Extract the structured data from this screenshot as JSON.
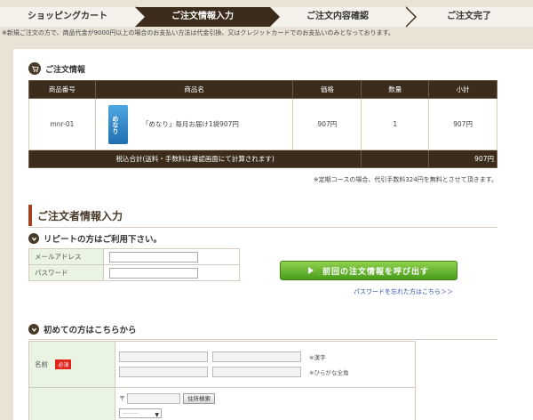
{
  "steps": [
    {
      "label": "ショッピングカート"
    },
    {
      "label": "ご注文情報入力"
    },
    {
      "label": "ご注文内容確認"
    },
    {
      "label": "ご注文完了"
    }
  ],
  "notice": "※新規ご注文の方で、商品代金が9000円以上の場合のお支払い方法は代金引換、又はクレジットカードでのお支払いのみとなっております。",
  "order_section": {
    "title": "ご注文情報",
    "headers": [
      "商品番号",
      "商品名",
      "価格",
      "数量",
      "小計"
    ],
    "row": {
      "code": "mnr-01",
      "image_text": "めなり",
      "name": "「めなり」毎月お届け1袋907円",
      "price": "907円",
      "qty": "1",
      "subtotal": "907円"
    },
    "sum_label": "税込合計(送料・手数料は確認画面にて計算されます)",
    "sum_value": "907円",
    "note": "※定期コースの場合、代引手数料324円を無料とさせて頂きます。"
  },
  "orderer_section": {
    "title": "ご注文者情報入力"
  },
  "repeat_section": {
    "title": "リピートの方はご利用下さい。",
    "email_label": "メールアドレス",
    "password_label": "パスワード",
    "call_button": "前回の注文情報を呼び出す",
    "forgot_link": "パスワードを忘れた方はこちら＞＞"
  },
  "first_section": {
    "title": "初めての方はこちらから",
    "name_label": "名前",
    "required_badge": "必須",
    "kanji_hint": "※漢字",
    "kana_hint": "※ひらがな全角",
    "zip_mark": "〒",
    "zip_button": "住所検索",
    "pref_placeholder": "--------"
  }
}
